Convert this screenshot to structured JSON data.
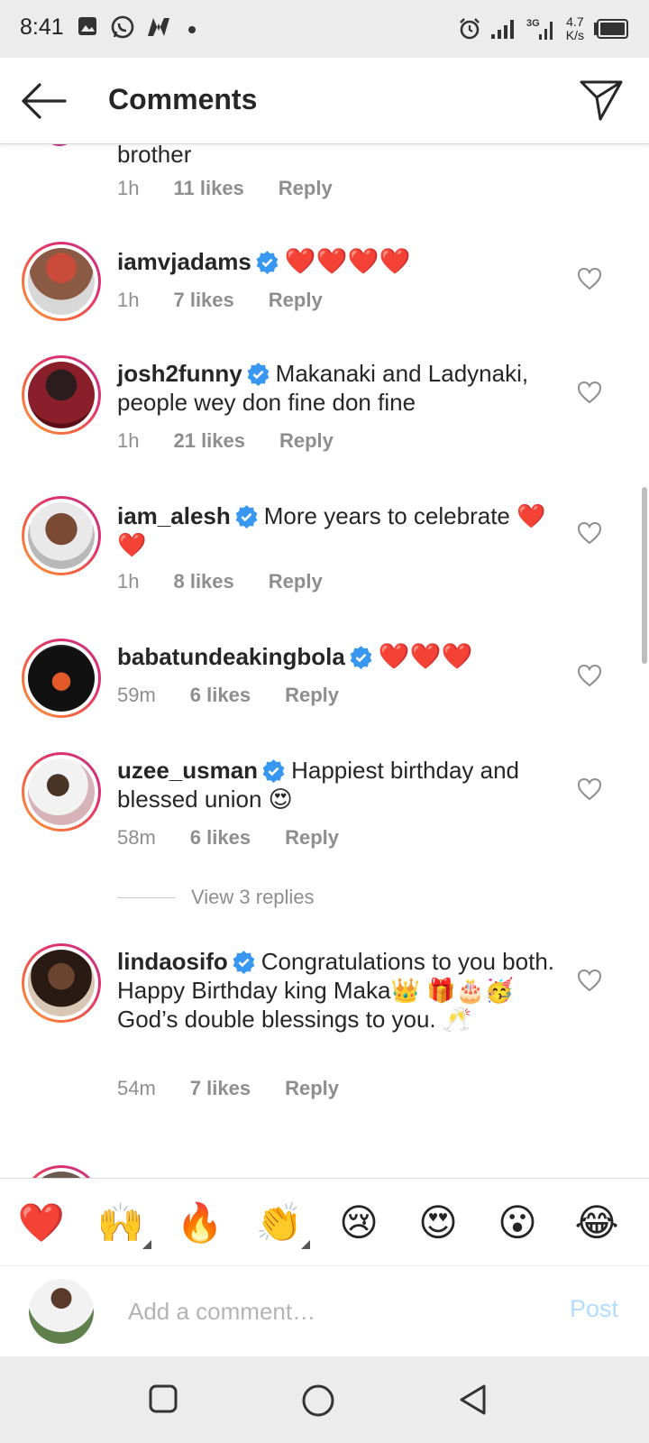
{
  "status_bar": {
    "time": "8:41",
    "network_speed_value": "4.7",
    "network_speed_unit": "K/s",
    "network_type": "3G"
  },
  "header": {
    "title": "Comments",
    "back_icon": "arrow-left-icon",
    "send_icon": "paper-plane-icon"
  },
  "partial_comment": {
    "text": "brother",
    "time": "1h",
    "likes": "11 likes",
    "reply": "Reply"
  },
  "comments": [
    {
      "username": "iamvjadams",
      "text": "❤️❤️❤️❤️",
      "time": "1h",
      "likes": "7 likes",
      "reply": "Reply"
    },
    {
      "username": "josh2funny",
      "text": "Makanaki and Ladynaki, people wey don fine don fine",
      "time": "1h",
      "likes": "21 likes",
      "reply": "Reply"
    },
    {
      "username": "iam_alesh",
      "text": "More years to celebrate ❤️❤️",
      "time": "1h",
      "likes": "8 likes",
      "reply": "Reply"
    },
    {
      "username": "babatundeakingbola",
      "text": "❤️❤️❤️",
      "time": "59m",
      "likes": "6 likes",
      "reply": "Reply"
    },
    {
      "username": "uzee_usman",
      "text": "Happiest birthday and blessed union 😍",
      "time": "58m",
      "likes": "6 likes",
      "reply": "Reply",
      "view_replies": "View 3 replies"
    },
    {
      "username": "lindaosifo",
      "text": "Congratulations to you both.",
      "text2": "Happy Birthday king Maka👑 🎁🎂🥳",
      "text3": "God’s double blessings to you. 🥂",
      "time": "54m",
      "likes": "7 likes",
      "reply": "Reply"
    }
  ],
  "emoji_bar": [
    "❤️",
    "🙌",
    "🔥",
    "👏",
    "😢",
    "😍",
    "😮",
    "😂"
  ],
  "comment_bar": {
    "placeholder": "Add a comment…",
    "post_label": "Post"
  },
  "colors": {
    "verified": "#3897f0",
    "post_disabled": "#b3dbff",
    "meta_gray": "#8e8e8e"
  }
}
